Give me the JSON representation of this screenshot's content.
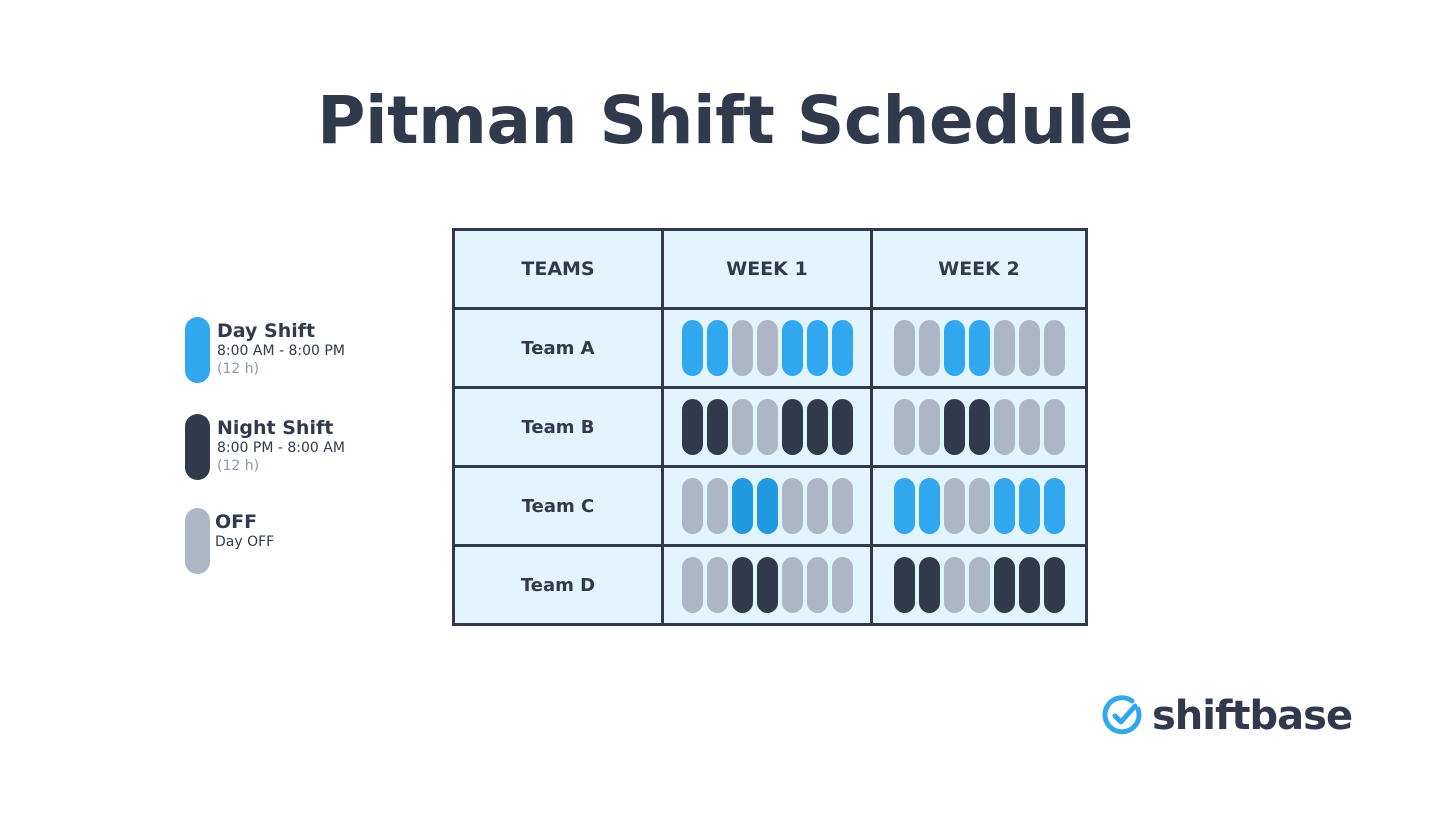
{
  "title": "Pitman Shift Schedule",
  "colors": {
    "day": "#31a7ef",
    "day_alt": "#2199e0",
    "night": "#313a4c",
    "off": "#adb6c6",
    "cell_bg": "#e2f4fd",
    "border": "#313a4c"
  },
  "legend": [
    {
      "type": "day",
      "name": "Day Shift",
      "time": "8:00 AM - 8:00 PM",
      "duration": "(12 h)"
    },
    {
      "type": "night",
      "name": "Night Shift",
      "time": "8:00 PM - 8:00 AM",
      "duration": "(12 h)"
    },
    {
      "type": "off",
      "name": "OFF",
      "time": "Day OFF",
      "duration": ""
    }
  ],
  "table": {
    "headers": [
      "TEAMS",
      "WEEK 1",
      "WEEK 2"
    ],
    "rows": [
      {
        "team": "Team A",
        "week1": [
          "day",
          "day",
          "off",
          "off",
          "day",
          "day",
          "day"
        ],
        "week2": [
          "off",
          "off",
          "day",
          "day",
          "off",
          "off",
          "off"
        ]
      },
      {
        "team": "Team B",
        "week1": [
          "night",
          "night",
          "off",
          "off",
          "night",
          "night",
          "night"
        ],
        "week2": [
          "off",
          "off",
          "night",
          "night",
          "off",
          "off",
          "off"
        ]
      },
      {
        "team": "Team C",
        "week1": [
          "off",
          "off",
          "day_alt",
          "day_alt",
          "off",
          "off",
          "off"
        ],
        "week2": [
          "day",
          "day",
          "off",
          "off",
          "day",
          "day",
          "day"
        ]
      },
      {
        "team": "Team D",
        "week1": [
          "off",
          "off",
          "night",
          "night",
          "off",
          "off",
          "off"
        ],
        "week2": [
          "night",
          "night",
          "off",
          "off",
          "night",
          "night",
          "night"
        ]
      }
    ]
  },
  "logo": {
    "icon": "check-circle-icon",
    "text": "shiftbase"
  }
}
